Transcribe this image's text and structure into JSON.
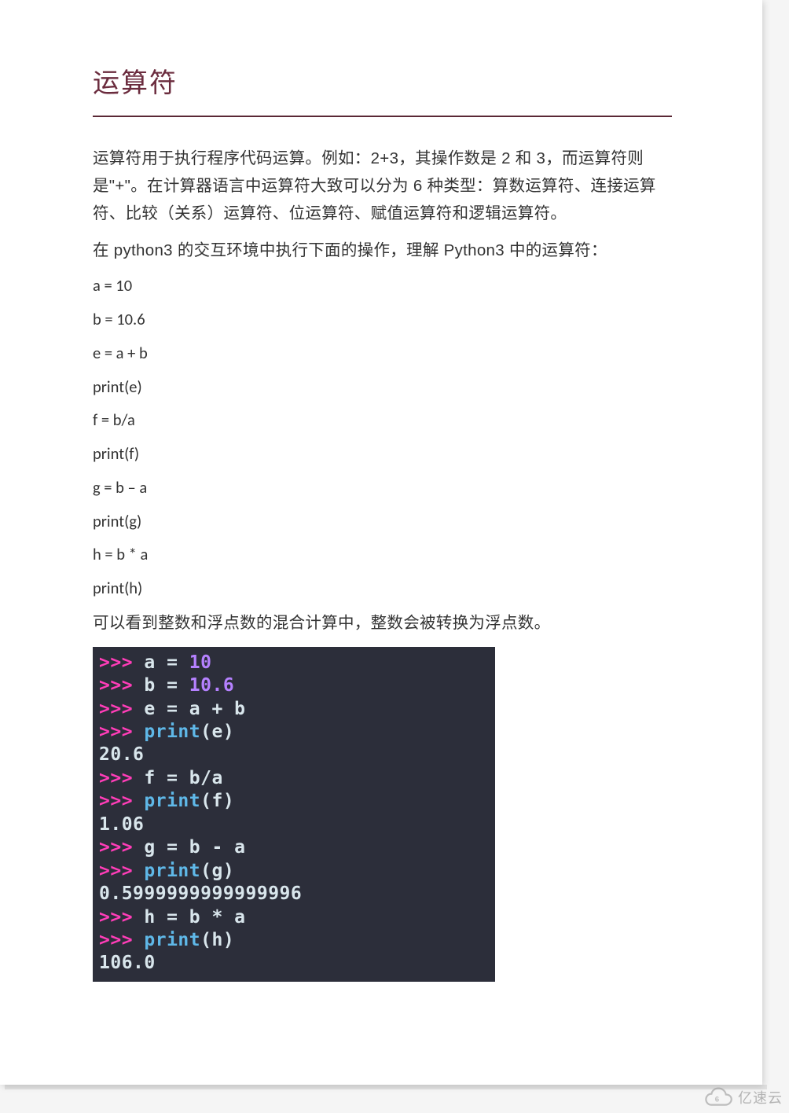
{
  "title": "运算符",
  "paragraphs": {
    "p1": "运算符用于执行程序代码运算。例如：2+3，其操作数是 2 和 3，而运算符则是\"+\"。在计算器语言中运算符大致可以分为 6 种类型：算数运算符、连接运算符、比较（关系）运算符、位运算符、赋值运算符和逻辑运算符。",
    "p2": "在 python3 的交互环境中执行下面的操作，理解 Python3 中的运算符：",
    "p3": "可以看到整数和浮点数的混合计算中，整数会被转换为浮点数。"
  },
  "code_lines": {
    "l1": "a = 10",
    "l2": "b = 10.6",
    "l3": "e = a + b",
    "l4": "print(e)",
    "l5": "f = b/a",
    "l6": "print(f)",
    "l7": "g = b – a",
    "l8": "print(g)",
    "l9": "h = b * a",
    "l10": "print(h)"
  },
  "terminal": {
    "prompt": ">>> ",
    "lines": [
      {
        "type": "in",
        "var": "a",
        "rest": " = ",
        "val": "10"
      },
      {
        "type": "in",
        "var": "b",
        "rest": " = ",
        "val": "10.6"
      },
      {
        "type": "in",
        "var": "e",
        "rest": " = a + b"
      },
      {
        "type": "call",
        "func": "print",
        "arg": "e"
      },
      {
        "type": "out",
        "text": "20.6"
      },
      {
        "type": "in",
        "var": "f",
        "rest": " = b/a"
      },
      {
        "type": "call",
        "func": "print",
        "arg": "f"
      },
      {
        "type": "out",
        "text": "1.06"
      },
      {
        "type": "in",
        "var": "g",
        "rest": " = b - a"
      },
      {
        "type": "call",
        "func": "print",
        "arg": "g"
      },
      {
        "type": "out",
        "text": "0.5999999999999996"
      },
      {
        "type": "in",
        "var": "h",
        "rest": " = b * a"
      },
      {
        "type": "call",
        "func": "print",
        "arg": "h"
      },
      {
        "type": "out",
        "text": "106.0"
      }
    ]
  },
  "watermark": {
    "text": "亿速云"
  }
}
